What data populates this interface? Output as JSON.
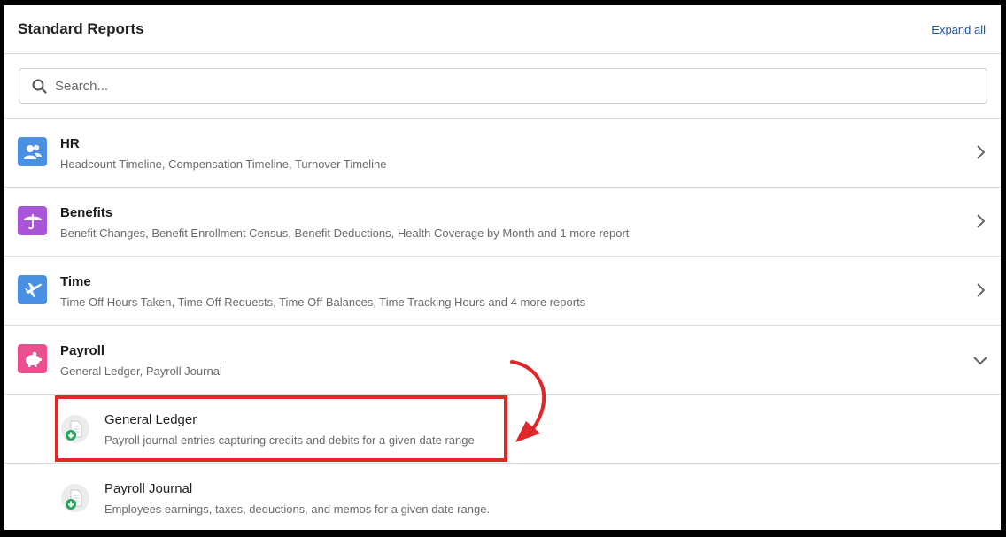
{
  "header": {
    "title": "Standard Reports",
    "expand_all": "Expand all"
  },
  "search": {
    "placeholder": "Search...",
    "icon": "search-icon"
  },
  "categories": [
    {
      "title": "HR",
      "subtitle": "Headcount Timeline, Compensation Timeline, Turnover Timeline",
      "icon": "people-icon",
      "color": "#4a90e2",
      "expanded": false
    },
    {
      "title": "Benefits",
      "subtitle": "Benefit Changes, Benefit Enrollment Census, Benefit Deductions, Health Coverage by Month and 1 more report",
      "icon": "umbrella-icon",
      "color": "#a855d8",
      "expanded": false
    },
    {
      "title": "Time",
      "subtitle": "Time Off Hours Taken, Time Off Requests, Time Off Balances, Time Tracking Hours and 4 more reports",
      "icon": "airplane-icon",
      "color": "#4a90e2",
      "expanded": false
    },
    {
      "title": "Payroll",
      "subtitle": "General Ledger, Payroll Journal",
      "icon": "piggy-bank-icon",
      "color": "#ec4f8e",
      "expanded": true
    }
  ],
  "payroll_reports": [
    {
      "title": "General Ledger",
      "subtitle": "Payroll journal entries capturing credits and debits for a given date range",
      "icon": "document-download-icon",
      "highlighted": true
    },
    {
      "title": "Payroll Journal",
      "subtitle": "Employees earnings, taxes, deductions, and memos for a given date range.",
      "icon": "document-download-icon",
      "highlighted": false
    }
  ],
  "annotation_color": "#e02828"
}
